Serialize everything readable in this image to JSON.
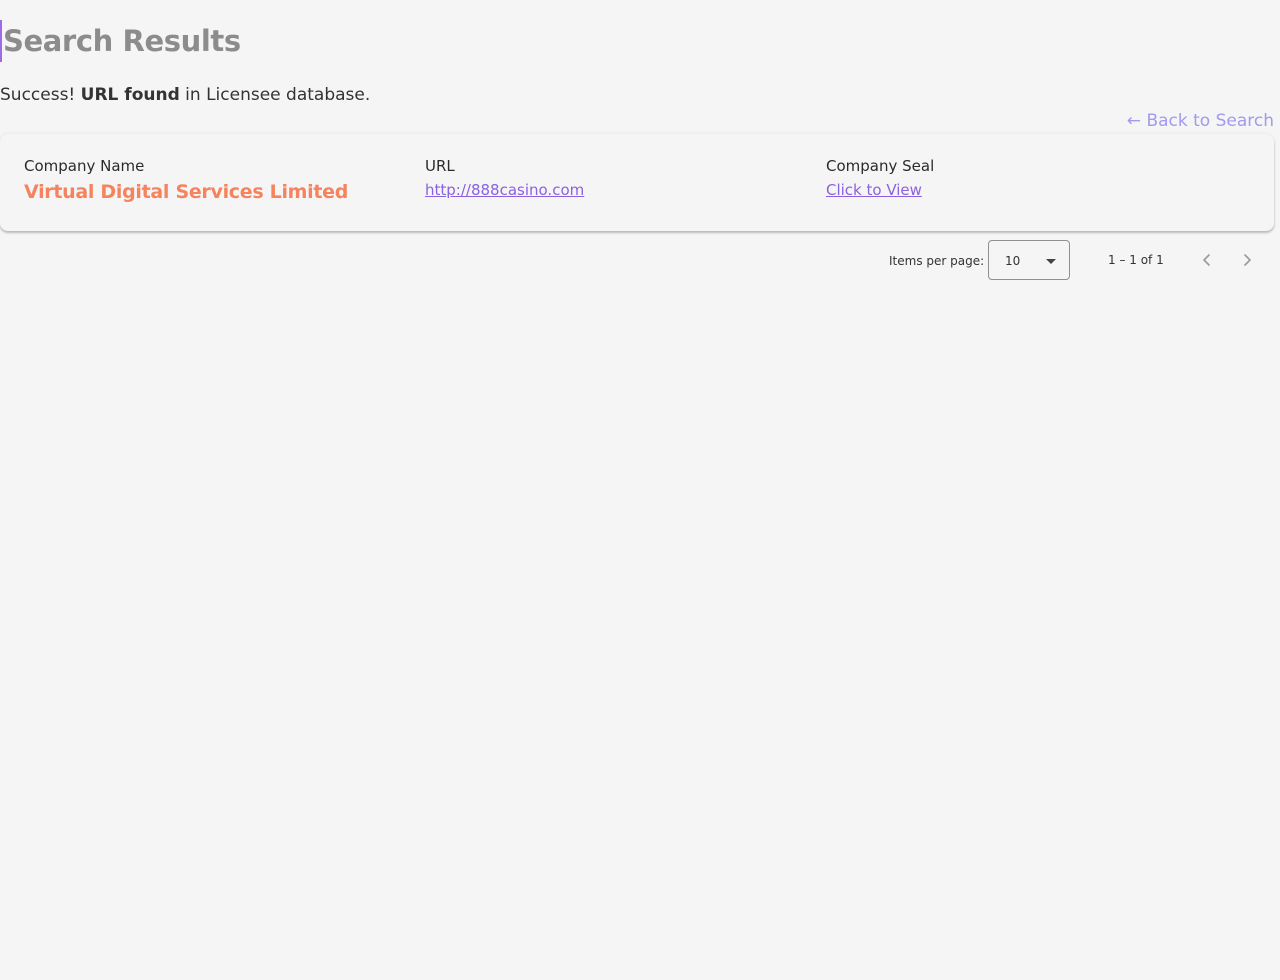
{
  "header": {
    "title": "Search Results"
  },
  "status": {
    "prefix": "Success!",
    "emphasis": "URL found",
    "suffix": "in Licensee database."
  },
  "back_link": {
    "label": "← Back to Search"
  },
  "results": {
    "columns": {
      "company_name": "Company Name",
      "url": "URL",
      "company_seal": "Company Seal"
    },
    "rows": [
      {
        "company_name": "Virtual Digital Services Limited",
        "url": "http://888casino.com",
        "seal_link": "Click to View"
      }
    ]
  },
  "paginator": {
    "items_per_page_label": "Items per page:",
    "items_per_page_value": "10",
    "range_label": "1 – 1 of 1",
    "prev_icon": "chevron-left-icon",
    "next_icon": "chevron-right-icon"
  },
  "colors": {
    "accent": "#9b6bea",
    "company_name": "#f5845e",
    "link": "#8a62e0",
    "back_link": "#a09bee",
    "title": "#8c8c8c"
  }
}
